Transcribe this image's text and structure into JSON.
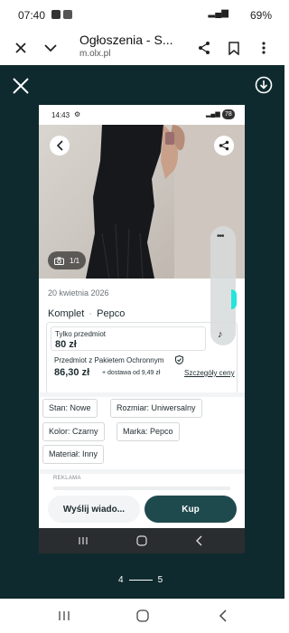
{
  "status_bar": {
    "time": "07:40",
    "battery": "69%"
  },
  "browser": {
    "title": "Ogłoszenia - S...",
    "url": "m.olx.pl"
  },
  "inner": {
    "time": "14:43",
    "badge": "78",
    "photo_counter": "1/1",
    "date": "20 kwietnia 2026",
    "title_part1": "Komplet",
    "title_part2": "Pepco",
    "price_box": {
      "label": "Tylko przedmiot",
      "price": "80 zł",
      "protection_label": "Przedmiot z Pakietem Ochronnym",
      "protection_price": "86,30 zł",
      "shipping": "+ dostawa od 9,49 zł",
      "details_link": "Szczegóły ceny"
    },
    "attributes": [
      "Stan: Nowe",
      "Rozmiar: Uniwersalny",
      "Kolor: Czarny",
      "Marka: Pepco",
      "Materiał: Inny"
    ],
    "ad_label": "REKLAMA",
    "message_button": "Wyślij wiado...",
    "buy_button": "Kup"
  },
  "pager": {
    "current": "4",
    "next": "5"
  },
  "colors": {
    "dark_bg": "#0e2a2e",
    "olx_teal": "#1e4a4e",
    "accent_teal": "#23e5db"
  }
}
